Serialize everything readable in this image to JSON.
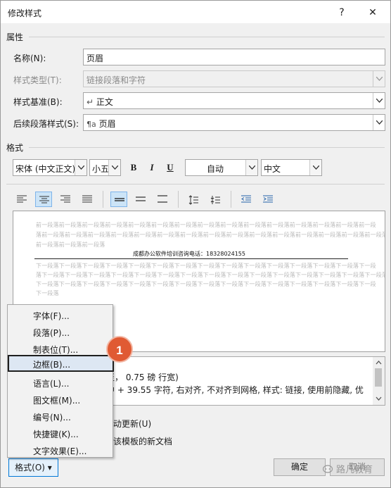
{
  "window": {
    "title": "修改样式",
    "help_label": "?",
    "close_label": "✕"
  },
  "properties": {
    "section_label": "属性",
    "name_label": "名称(N):",
    "name_value": "页眉",
    "style_type_label": "样式类型(T):",
    "style_type_value": "链接段落和字符",
    "based_on_label": "样式基准(B):",
    "based_on_icon": "↵",
    "based_on_value": "正文",
    "next_para_label": "后续段落样式(S):",
    "next_para_icon": "¶a",
    "next_para_value": "页眉"
  },
  "format_section": {
    "section_label": "格式",
    "font_value": "宋体 (中文正文)",
    "size_value": "小五",
    "bold_label": "B",
    "italic_label": "I",
    "underline_label": "U",
    "color_value": "自动",
    "language_value": "中文"
  },
  "preview": {
    "prev_line_1": "前一段落前一段落前一段落前一段落前一段落前一段落前一段落前一段落前一段落前一段落前一段落前一段落前一段落前一段落前一段",
    "prev_line_2": "落前一段落前一段落前一段落前一段落前一段落前一段落前一段落前一段落前一段落前一段落前一段落前一段落前一段落前一段落前一段落",
    "prev_line_3": "前一段落前一段落前一段落",
    "main_text": "成都办公软件培训咨询电话：18328024155",
    "next_line_1": "下一段落下一段落下一段落下一段落下一段落下一段落下一段落下一段落下一段落下一段落下一段落下一段落下一段落下一段落下一段",
    "next_line_2": "落下一段落下一段落下一段落下一段落下一段落下一段落下一段落下一段落下一段落下一段落下一段落下一段落下一段落下一段落下一段落",
    "next_line_3": "下一段落下一段落下一段落下一段落下一段落下一段落下一段落下一段落下一段落下一段落下一段落下一段落下一段落下一段落下一段",
    "next_line_4": "下一段落"
  },
  "description": {
    "line_1": "至，  0.75 磅 行宽)",
    "line_2": "中 +  39.55 字符, 右对齐, 不对齐到网格, 样式: 链接, 使用前隐藏, 优"
  },
  "options": {
    "auto_update_label": "动更新(U)",
    "template_label": "该模板的新文档"
  },
  "format_menu": {
    "items": [
      {
        "label": "字体(F)..."
      },
      {
        "label": "段落(P)..."
      },
      {
        "label": "制表位(T)..."
      },
      {
        "label": "边框(B)..."
      },
      {
        "label": "语言(L)..."
      },
      {
        "label": "图文框(M)..."
      },
      {
        "label": "编号(N)..."
      },
      {
        "label": "快捷键(K)..."
      },
      {
        "label": "文字效果(E)..."
      }
    ],
    "highlighted_index": 3,
    "callout_number": "1"
  },
  "buttons": {
    "format_label": "格式(O) ▾",
    "ok_label": "确定",
    "cancel_label": "取消"
  },
  "watermark": {
    "text": "路凡教育"
  },
  "colors": {
    "accent": "#0078d7",
    "callout": "#e05a33",
    "menu_highlight": "#dde7f3"
  }
}
